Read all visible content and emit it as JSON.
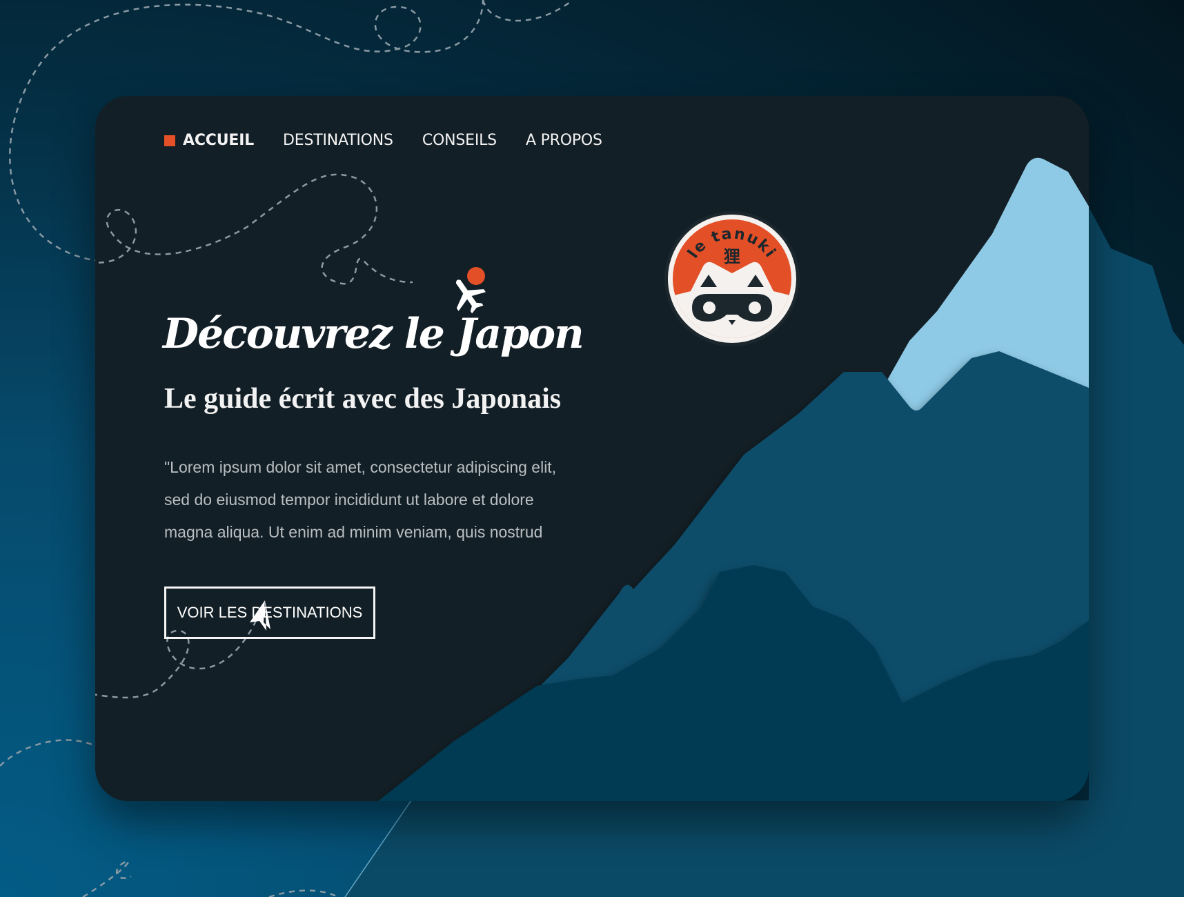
{
  "nav": {
    "items": [
      {
        "label": "ACCUEIL",
        "active": true
      },
      {
        "label": "DESTINATIONS",
        "active": false
      },
      {
        "label": "CONSEILS",
        "active": false
      },
      {
        "label": "A PROPOS",
        "active": false
      }
    ]
  },
  "hero": {
    "headline": "Découvrez le Japon",
    "subtitle": "Le guide écrit avec des Japonais",
    "body_lines": [
      "\"Lorem ipsum dolor sit amet, consectetur adipiscing elit,",
      "sed do  eiusmod tempor incididunt ut labore et dolore",
      "magna aliqua. Ut enim ad  minim veniam, quis nostrud"
    ],
    "cta_label": "VOIR LES DESTINATIONS"
  },
  "logo": {
    "text": "le tanuki",
    "kanji": "狸"
  },
  "colors": {
    "accent": "#e34f26",
    "card_bg": "#131f26",
    "mountain_snow": "#8ecae6",
    "mountain_mid": "#0c4e6a",
    "mountain_dark": "#023a52"
  },
  "icons": {
    "airplane": "airplane-icon",
    "paper_plane": "paper-plane-icon",
    "sun": "sun-icon",
    "nav_bullet": "square-bullet-icon"
  }
}
